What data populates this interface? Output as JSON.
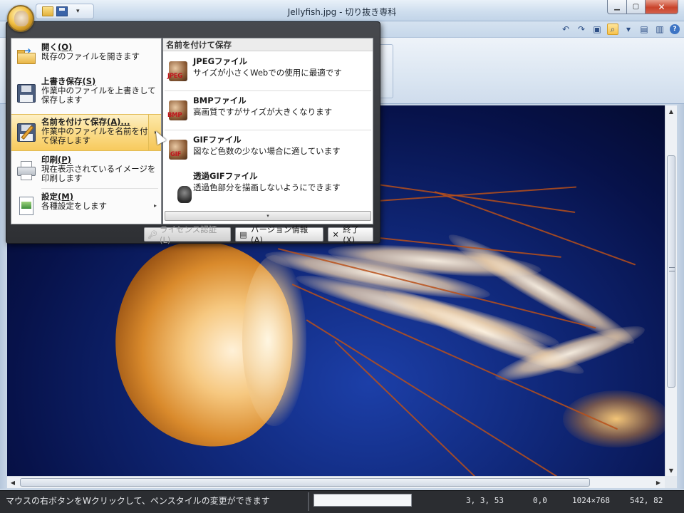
{
  "window": {
    "title": "Jellyfish.jpg - 切り抜き専科",
    "min_label": "▁",
    "max_label": "▢",
    "close_label": "✕"
  },
  "quick_access": {
    "more_label": "▾"
  },
  "menu": {
    "items": [
      {
        "title": "開く",
        "accel": "(O)",
        "desc": "既存のファイルを開きます"
      },
      {
        "title": "上書き保存",
        "accel": "(S)",
        "desc": "作業中のファイルを上書きして保存します"
      },
      {
        "title": "名前を付けて保存",
        "accel": "(A)...",
        "desc": "作業中のファイルを名前を付けて保存します",
        "arrow": "▸"
      },
      {
        "title": "印刷",
        "accel": "(P)",
        "desc": "現在表示されているイメージを印刷します"
      },
      {
        "title": "設定",
        "accel": "(M)",
        "desc": "各種設定をします",
        "arrow": "▸"
      }
    ],
    "submenu": {
      "header": "名前を付けて保存",
      "items": [
        {
          "title": "JPEGファイル",
          "desc": "サイズが小さくWebでの使用に最適です",
          "icon_label": "JPEG"
        },
        {
          "title": "BMPファイル",
          "desc": "高画質ですがサイズが大きくなります",
          "icon_label": "BMP"
        },
        {
          "title": "GIFファイル",
          "desc": "図など色数の少ない場合に適しています",
          "icon_label": "GIF"
        },
        {
          "title": "透過GIFファイル",
          "desc": "透過色部分を描画しないようにできます"
        }
      ],
      "scroll_label": "▾"
    },
    "buttons": {
      "license": "ライセンス認証(L)",
      "version": "バージョン情報(A)",
      "exit": "終了(X)"
    }
  },
  "status": {
    "message": "マウスの右ボタンをWクリックして、ペンスタイルの変更ができます",
    "color_value": "3,  3,  53",
    "position": "0,0",
    "image_size": "1024×768",
    "cursor_pos": "542, 82"
  },
  "scroll": {
    "up": "▲",
    "down": "▼",
    "left": "◀",
    "right": "▶"
  },
  "colors": {
    "accent": "#f7ca5d",
    "menu_dark": "#2e3034",
    "statusbar": "#2b2d31"
  }
}
